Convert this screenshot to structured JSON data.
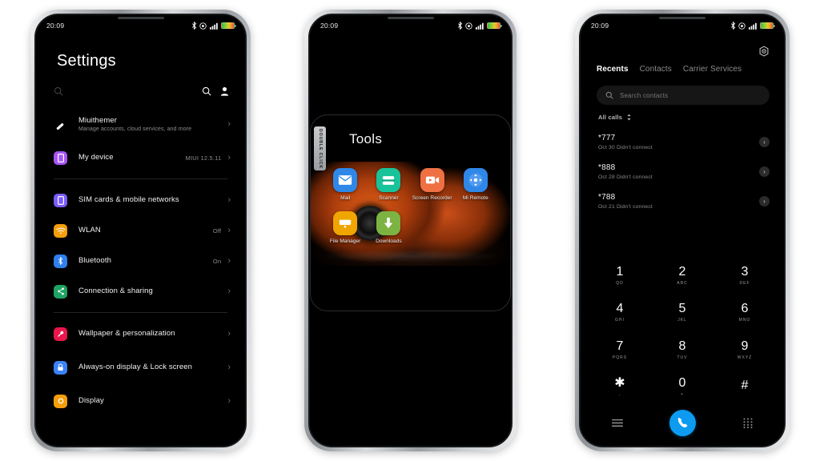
{
  "status_bar": {
    "time": "20:09",
    "icons": [
      "bluetooth-icon",
      "dnd-icon",
      "signal-icon",
      "battery-icon"
    ]
  },
  "phone1": {
    "title": "Settings",
    "search_placeholder": "",
    "actions": [
      "search-icon",
      "account-icon"
    ],
    "items": [
      {
        "label": "Miuithemer",
        "sub": "Manage accounts, cloud services, and more",
        "value": "",
        "icon_color": "#ffffff",
        "glyph": "account"
      },
      {
        "label": "My device",
        "sub": "",
        "value": "MIUI 12.5.11",
        "icon_color": "#a855f7",
        "glyph": "phone"
      },
      {
        "label": "SIM cards & mobile networks",
        "sub": "",
        "value": "",
        "icon_color": "#7c5cff",
        "glyph": "sim"
      },
      {
        "label": "WLAN",
        "sub": "",
        "value": "Off",
        "icon_color": "#f59e0b",
        "glyph": "wifi"
      },
      {
        "label": "Bluetooth",
        "sub": "",
        "value": "On",
        "icon_color": "#2f80ed",
        "glyph": "bt"
      },
      {
        "label": "Connection & sharing",
        "sub": "",
        "value": "",
        "icon_color": "#1fa463",
        "glyph": "share"
      },
      {
        "label": "Wallpaper & personalization",
        "sub": "",
        "value": "",
        "icon_color": "#e8174c",
        "glyph": "brush"
      },
      {
        "label": "Always-on display & Lock screen",
        "sub": "",
        "value": "",
        "icon_color": "#3b82f6",
        "glyph": "lock"
      },
      {
        "label": "Display",
        "sub": "",
        "value": "",
        "icon_color": "#f59e0b",
        "glyph": "sun"
      }
    ]
  },
  "phone2": {
    "folder_title": "Tools",
    "side_tag": "DOUBLE CLICK",
    "apps": [
      {
        "label": "Mail",
        "icon": "mail-icon",
        "color": "#2f87e8"
      },
      {
        "label": "Scanner",
        "icon": "scanner-icon",
        "color": "#18c39a"
      },
      {
        "label": "Screen Recorder",
        "icon": "screen-recorder-icon",
        "color": "#ef7043"
      },
      {
        "label": "Mi Remote",
        "icon": "mi-remote-icon",
        "color": "#2f87e8"
      },
      {
        "label": "File Manager",
        "icon": "file-manager-icon",
        "color": "#f0a500"
      },
      {
        "label": "Downloads",
        "icon": "downloads-icon",
        "color": "#7cb342"
      }
    ]
  },
  "phone3": {
    "tabs": [
      {
        "label": "Recents",
        "active": true
      },
      {
        "label": "Contacts",
        "active": false
      },
      {
        "label": "Carrier Services",
        "active": false
      }
    ],
    "settings_icon": "gear-icon",
    "search_placeholder": "Search contacts",
    "filter_label": "All calls",
    "calls": [
      {
        "number": "*777",
        "meta": "Oct 30 Didn't connect"
      },
      {
        "number": "*888",
        "meta": "Oct 28 Didn't connect"
      },
      {
        "number": "*788",
        "meta": "Oct 21 Didn't connect"
      }
    ],
    "keys": [
      {
        "digit": "1",
        "sub": "QD"
      },
      {
        "digit": "2",
        "sub": "ABC"
      },
      {
        "digit": "3",
        "sub": "DEF"
      },
      {
        "digit": "4",
        "sub": "GHI"
      },
      {
        "digit": "5",
        "sub": "JKL"
      },
      {
        "digit": "6",
        "sub": "MNO"
      },
      {
        "digit": "7",
        "sub": "PQRS"
      },
      {
        "digit": "8",
        "sub": "TUV"
      },
      {
        "digit": "9",
        "sub": "WXYZ"
      },
      {
        "digit": "✱",
        "sub": ","
      },
      {
        "digit": "0",
        "sub": "+"
      },
      {
        "digit": "#",
        "sub": ""
      }
    ],
    "pad_bar": {
      "menu": "menu-icon",
      "call": "call-icon",
      "keypad": "keypad-icon",
      "call_color": "#0c9bf0"
    }
  }
}
